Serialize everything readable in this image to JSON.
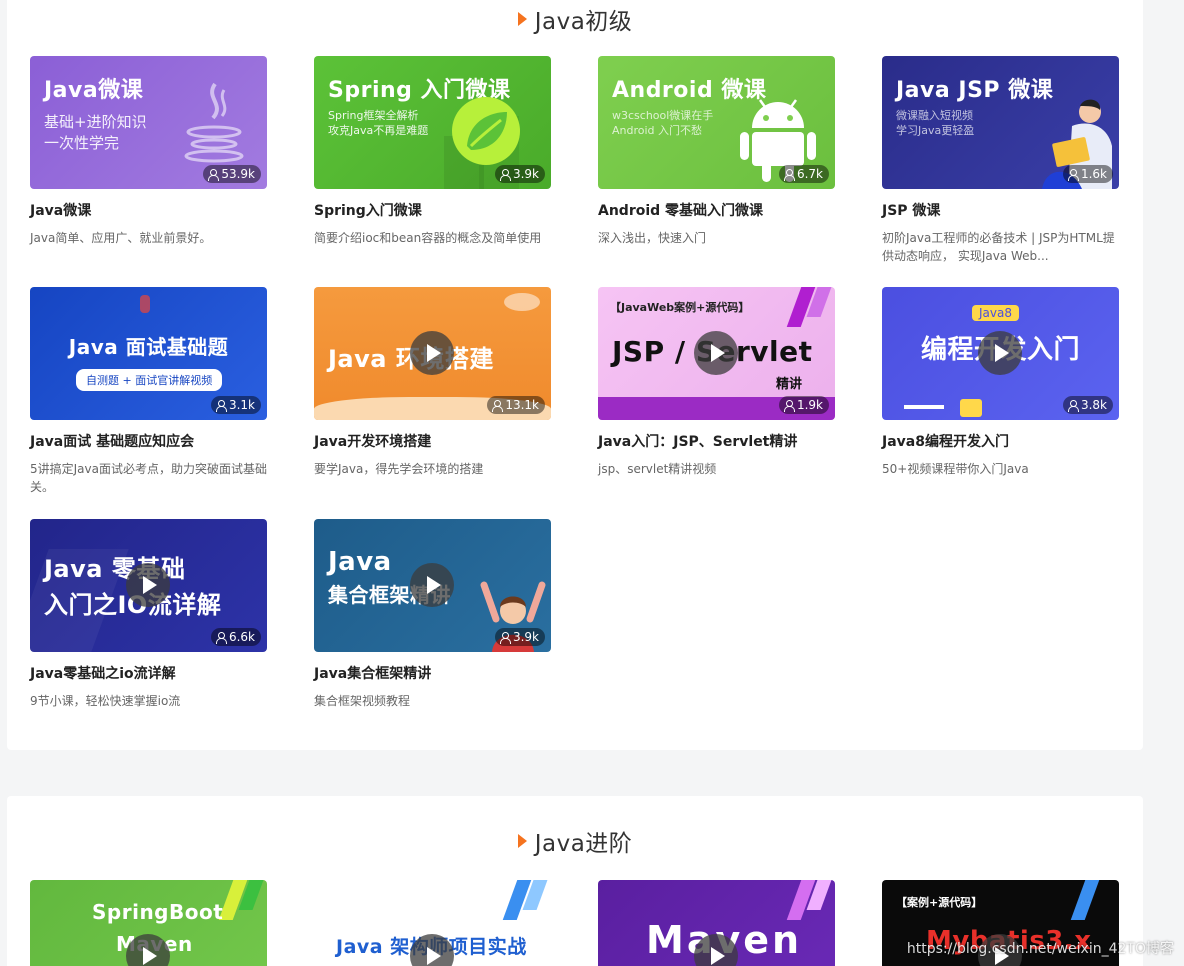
{
  "sections": [
    {
      "title": "Java初级",
      "cards": [
        {
          "thumb_title": "Java微课",
          "thumb_sub": "基础+进阶知识\n一次性学完",
          "count": "53.9k",
          "title": "Java微课",
          "desc": "Java简单、应用广、就业前景好。"
        },
        {
          "thumb_title": "Spring 入门微课",
          "thumb_sub": "Spring框架全解析\n攻克Java不再是难题",
          "count": "3.9k",
          "title": "Spring入门微课",
          "desc": "简要介绍ioc和bean容器的概念及简单使用"
        },
        {
          "thumb_title": "Android 微课",
          "thumb_sub": "w3cschool微课在手\nAndroid  入门不愁",
          "count": "6.7k",
          "title": "Android 零基础入门微课",
          "desc": "深入浅出，快速入门"
        },
        {
          "thumb_title": "Java JSP 微课",
          "thumb_sub": "微课融入短视频\n学习Java更轻盈",
          "count": "1.6k",
          "title": "JSP 微课",
          "desc": "初阶Java工程师的必备技术 | JSP为HTML提供动态响应， 实现Java Web..."
        },
        {
          "thumb_title": "Java 面试基础题",
          "thumb_sub": "自测题 + 面试官讲解视频",
          "count": "3.1k",
          "title": "Java面试 基础题应知应会",
          "desc": "5讲搞定Java面试必考点，助力突破面试基础关。"
        },
        {
          "thumb_title": "Java 环境搭建",
          "thumb_sub": "",
          "count": "13.1k",
          "title": "Java开发环境搭建",
          "desc": "要学Java，得先学会环境的搭建"
        },
        {
          "thumb_title": "JSP / Servlet",
          "thumb_sub": "【JavaWeb案例+源代码】",
          "thumb_tag": "精讲",
          "count": "1.9k",
          "title": "Java入门：JSP、Servlet精讲",
          "desc": "jsp、servlet精讲视频"
        },
        {
          "thumb_title": "编程开发入门",
          "thumb_sub": "Java8",
          "count": "3.8k",
          "title": "Java8编程开发入门",
          "desc": "50+视频课程带你入门Java"
        },
        {
          "thumb_title": "Java 零基础",
          "thumb_sub": "入门之IO流详解",
          "count": "6.6k",
          "title": "Java零基础之io流详解",
          "desc": "9节小课，轻松快速掌握io流"
        },
        {
          "thumb_title": "Java",
          "thumb_sub": "集合框架精讲",
          "count": "3.9k",
          "title": "Java集合框架精讲",
          "desc": "集合框架视频教程"
        }
      ]
    },
    {
      "title": "Java进阶",
      "cards": [
        {
          "thumb_title": "SpringBoot",
          "thumb_sub": "Maven"
        },
        {
          "thumb_title": "Java 架构师项目实战",
          "thumb_sub": ""
        },
        {
          "thumb_title": "Maven",
          "thumb_sub": ""
        },
        {
          "thumb_title": "Mybatis3.x",
          "thumb_sub": "【案例+源代码】"
        }
      ]
    }
  ],
  "watermark": "https://blog.csdn.net/weixin_42TO博客",
  "colors": {
    "accent": "#f5731f"
  }
}
